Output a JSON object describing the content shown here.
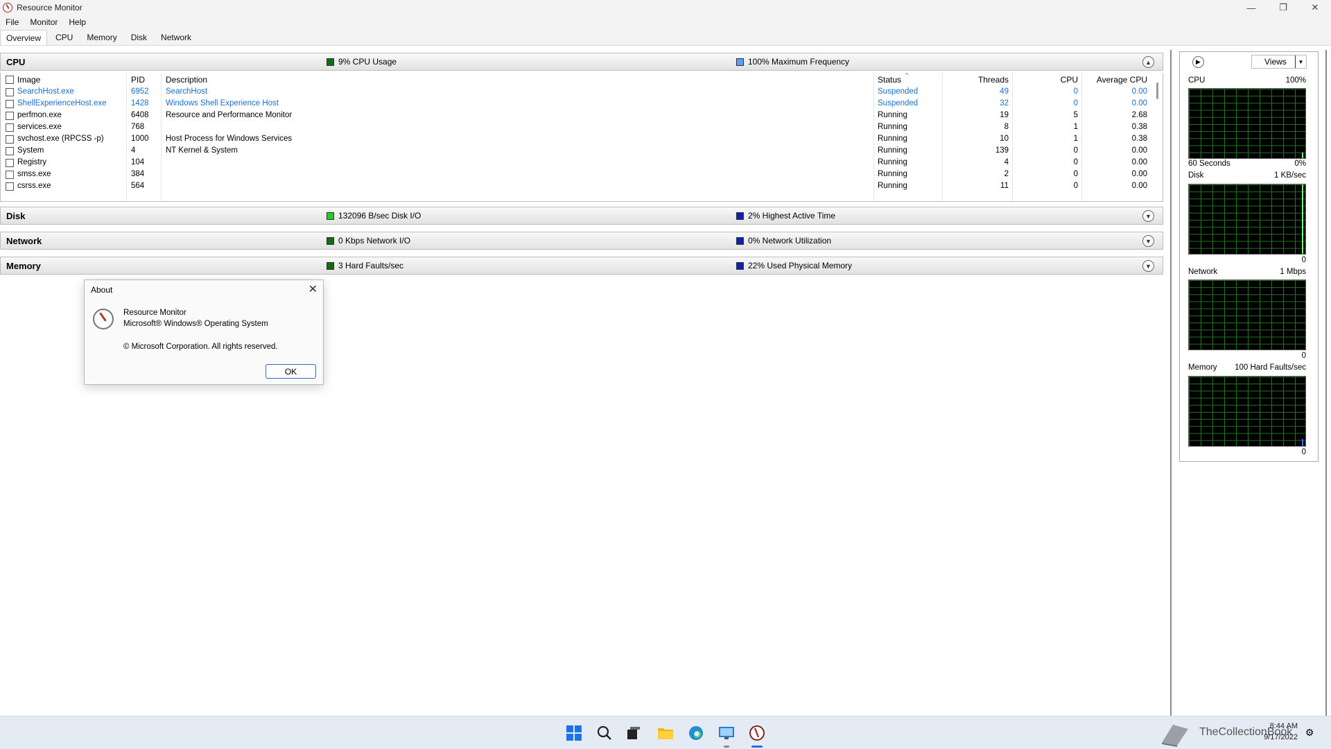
{
  "window": {
    "title": "Resource Monitor",
    "minimize": "—",
    "restore": "❐",
    "close": "✕"
  },
  "menu": {
    "items": [
      "File",
      "Monitor",
      "Help"
    ]
  },
  "tabs": [
    "Overview",
    "CPU",
    "Memory",
    "Disk",
    "Network"
  ],
  "cpu_section": {
    "title": "CPU",
    "legend1": "9% CPU Usage",
    "legend2": "100% Maximum Frequency",
    "legend1_color": "#0f6e0f",
    "legend2_color": "#5aa0ee",
    "columns": {
      "image": "Image",
      "pid": "PID",
      "description": "Description",
      "status": "Status",
      "threads": "Threads",
      "cpu": "CPU",
      "avg_cpu": "Average CPU"
    },
    "rows": [
      {
        "image": "SearchHost.exe",
        "pid": "6952",
        "description": "SearchHost",
        "status": "Suspended",
        "threads": "49",
        "cpu": "0",
        "avg_cpu": "0.00"
      },
      {
        "image": "ShellExperienceHost.exe",
        "pid": "1428",
        "description": "Windows Shell Experience Host",
        "status": "Suspended",
        "threads": "32",
        "cpu": "0",
        "avg_cpu": "0.00"
      },
      {
        "image": "perfmon.exe",
        "pid": "6408",
        "description": "Resource and Performance Monitor",
        "status": "Running",
        "threads": "19",
        "cpu": "5",
        "avg_cpu": "2.68"
      },
      {
        "image": "services.exe",
        "pid": "768",
        "description": "",
        "status": "Running",
        "threads": "8",
        "cpu": "1",
        "avg_cpu": "0.38"
      },
      {
        "image": "svchost.exe (RPCSS -p)",
        "pid": "1000",
        "description": "Host Process for Windows Services",
        "status": "Running",
        "threads": "10",
        "cpu": "1",
        "avg_cpu": "0.38"
      },
      {
        "image": "System",
        "pid": "4",
        "description": "NT Kernel & System",
        "status": "Running",
        "threads": "139",
        "cpu": "0",
        "avg_cpu": "0.00"
      },
      {
        "image": "Registry",
        "pid": "104",
        "description": "",
        "status": "Running",
        "threads": "4",
        "cpu": "0",
        "avg_cpu": "0.00"
      },
      {
        "image": "smss.exe",
        "pid": "384",
        "description": "",
        "status": "Running",
        "threads": "2",
        "cpu": "0",
        "avg_cpu": "0.00"
      },
      {
        "image": "csrss.exe",
        "pid": "564",
        "description": "",
        "status": "Running",
        "threads": "11",
        "cpu": "0",
        "avg_cpu": "0.00"
      }
    ]
  },
  "disk_section": {
    "title": "Disk",
    "legend1": "132096 B/sec Disk I/O",
    "legend2": "2% Highest Active Time",
    "legend1_color": "#22cc22",
    "legend2_color": "#1020b0"
  },
  "network_section": {
    "title": "Network",
    "legend1": "0 Kbps Network I/O",
    "legend2": "0% Network Utilization",
    "legend1_color": "#0f6e0f",
    "legend2_color": "#1020b0"
  },
  "memory_section": {
    "title": "Memory",
    "legend1": "3 Hard Faults/sec",
    "legend2": "22% Used Physical Memory",
    "legend1_color": "#0f6e0f",
    "legend2_color": "#1020b0"
  },
  "about_dialog": {
    "title": "About",
    "line1": "Resource Monitor",
    "line2": "Microsoft® Windows® Operating System",
    "line3": "© Microsoft Corporation. All rights reserved.",
    "ok": "OK"
  },
  "right_panel": {
    "views": "Views",
    "cpu": {
      "label": "CPU",
      "max": "100%",
      "footer_left": "60 Seconds",
      "footer_right": "0%"
    },
    "disk": {
      "label": "Disk",
      "max": "1 KB/sec",
      "footer_right": "0"
    },
    "network": {
      "label": "Network",
      "max": "1 Mbps",
      "footer_right": "0"
    },
    "memory": {
      "label": "Memory",
      "max": "100 Hard Faults/sec",
      "footer_right": "0"
    }
  },
  "taskbar": {
    "time": "8:44 AM",
    "date": "9/17/2022",
    "watermark": "TheCollectionBook",
    "icons": [
      "start-icon",
      "search-icon",
      "task-view-icon",
      "file-explorer-icon",
      "edge-icon",
      "control-panel-icon",
      "resource-monitor-icon"
    ]
  }
}
